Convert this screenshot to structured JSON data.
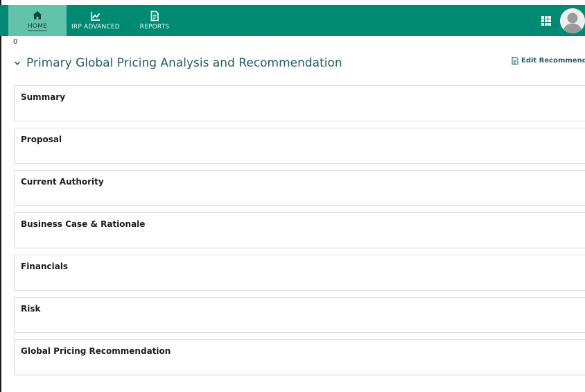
{
  "nav": {
    "items": [
      {
        "label": "HOME",
        "icon": "home-icon",
        "active": true
      },
      {
        "label": "IRP ADVANCED",
        "icon": "trend-chart-icon",
        "active": false
      },
      {
        "label": "REPORTS",
        "icon": "document-icon",
        "active": false
      }
    ],
    "apps_icon": "grid-icon",
    "avatar_icon": "user-avatar-icon"
  },
  "counter": "0",
  "section": {
    "title": "Primary Global Pricing Analysis and Recommendation",
    "edit_label": "Edit Recommenda"
  },
  "cards": [
    {
      "title": "Summary"
    },
    {
      "title": "Proposal"
    },
    {
      "title": "Current Authority"
    },
    {
      "title": "Business Case & Rationale"
    },
    {
      "title": "Financials"
    },
    {
      "title": "Risk"
    },
    {
      "title": "Global Pricing Recommendation"
    }
  ],
  "colors": {
    "navbar": "#008a74",
    "nav_active": "#63c3aa",
    "accent_text": "#245c66",
    "card_border": "#d9d9d9"
  }
}
